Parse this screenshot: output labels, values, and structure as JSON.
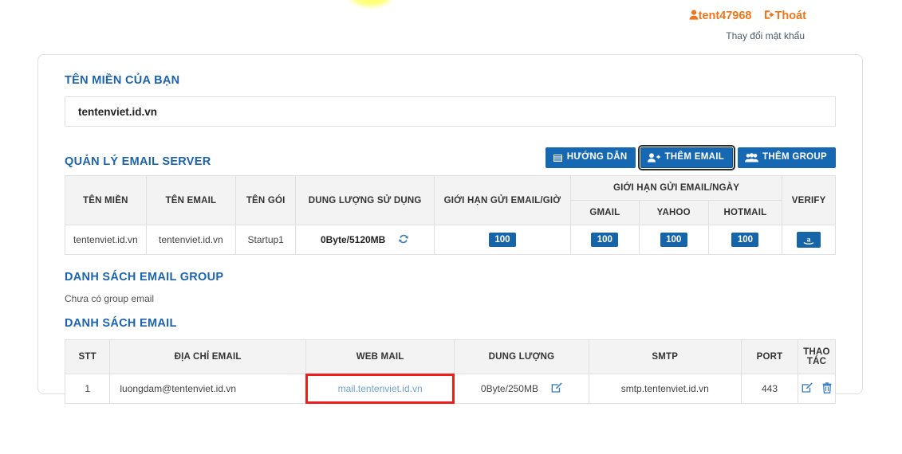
{
  "account": {
    "username": "tent47968",
    "logout_label": "Thoát",
    "change_password_label": "Thay đổi mật khẩu",
    "accent_color": "#f0751b",
    "link_color": "#4a5a6a"
  },
  "domain_section": {
    "title": "TÊN MIỀN CỦA BẠN",
    "domain_value": "tentenviet.id.vn"
  },
  "email_server_section": {
    "title": "QUẢN LÝ EMAIL SERVER",
    "buttons": [
      {
        "label": "HƯỚNG DẪN",
        "icon": "book-icon",
        "focused": false
      },
      {
        "label": "THÊM EMAIL",
        "icon": "user-plus-icon",
        "focused": true
      },
      {
        "label": "THÊM GROUP",
        "icon": "users-group-icon",
        "focused": false
      }
    ],
    "headers": {
      "domain": "TÊN MIỀN",
      "email_name": "TÊN EMAIL",
      "package": "TÊN GÓI",
      "usage": "DUNG LƯỢNG SỬ DỤNG",
      "limit_hour": "GIỚI HẠN GỬI EMAIL/GIỜ",
      "limit_day": "GIỚI HẠN GỬI EMAIL/NGÀY",
      "gmail": "GMAIL",
      "yahoo": "YAHOO",
      "hotmail": "HOTMAIL",
      "verify": "VERIFY"
    },
    "rows": [
      {
        "domain": "tentenviet.id.vn",
        "email_name": "tentenviet.id.vn",
        "package": "Startup1",
        "usage": "0Byte/5120MB",
        "usage_icon": "refresh-icon",
        "limit_hour": "100",
        "gmail": "100",
        "yahoo": "100",
        "hotmail": "100",
        "verify_icon": "amazon-icon"
      }
    ],
    "badge_color": "#1565a8",
    "button_color": "#1768b2"
  },
  "email_group_section": {
    "title": "DANH SÁCH EMAIL GROUP",
    "empty_text": "Chưa có group email"
  },
  "email_list_section": {
    "title": "DANH SÁCH EMAIL",
    "headers": {
      "stt": "STT",
      "address": "ĐỊA CHỈ EMAIL",
      "webmail": "WEB MAIL",
      "quota": "DUNG LƯỢNG",
      "smtp": "SMTP",
      "port": "PORT",
      "action": "THAO TÁC"
    },
    "rows": [
      {
        "stt": "1",
        "address": "luongdam@tentenviet.id.vn",
        "webmail": "mail.tentenviet.id.vn",
        "webmail_highlighted": true,
        "quota": "0Byte/250MB",
        "quota_icon": "edit-icon",
        "smtp": "smtp.tentenviet.id.vn",
        "port": "443",
        "action_icons": [
          "edit-icon",
          "trash-icon"
        ]
      }
    ],
    "highlight_color": "#ee1c1c"
  }
}
